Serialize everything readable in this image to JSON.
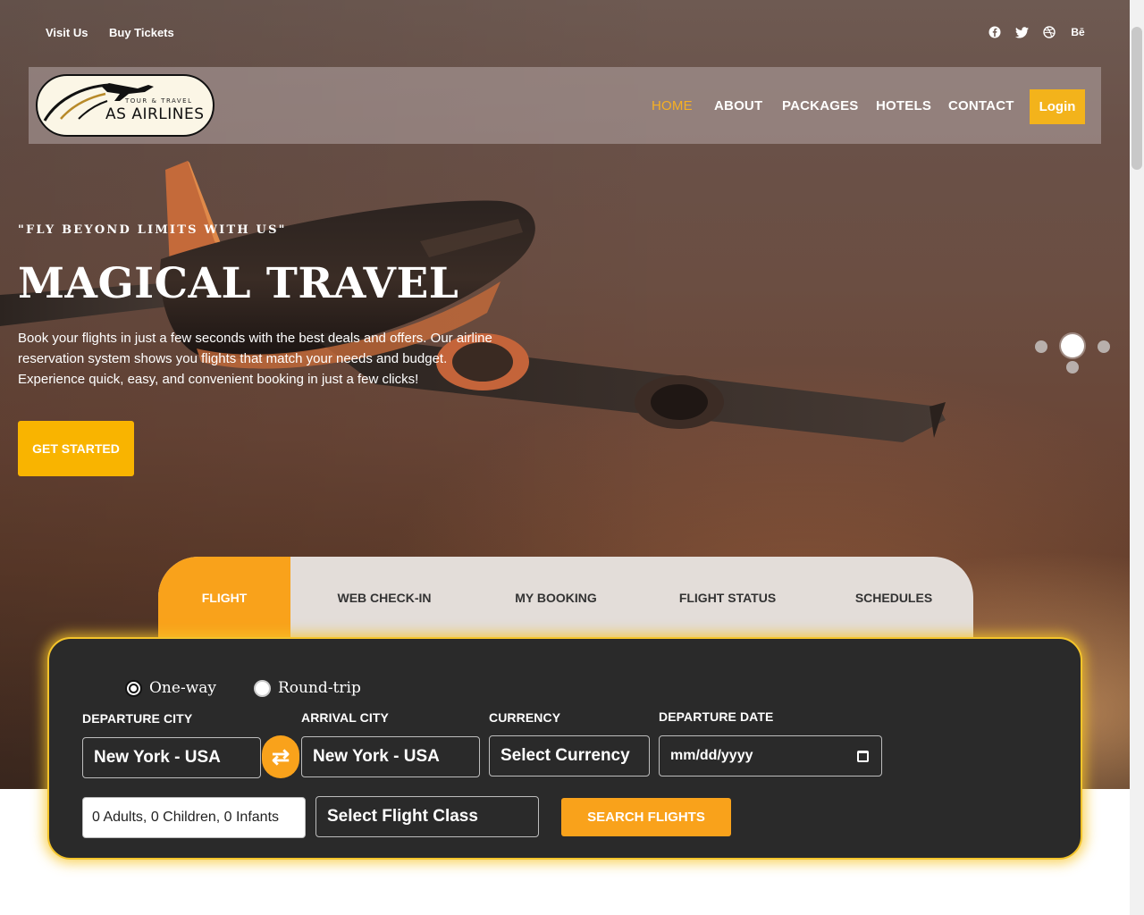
{
  "topbar": {
    "visit_us": "Visit Us",
    "buy_tickets": "Buy Tickets",
    "social": [
      {
        "icon": "facebook-icon",
        "glyph": "f"
      },
      {
        "icon": "twitter-icon",
        "glyph": "t"
      },
      {
        "icon": "dribbble-icon",
        "glyph": "✺"
      },
      {
        "icon": "behance-icon",
        "glyph": "Bē"
      }
    ]
  },
  "logo": {
    "small": "TOUR & TRAVEL",
    "big": "AS AIRLINES"
  },
  "nav": {
    "items": [
      "HOME",
      "ABOUT",
      "PACKAGES",
      "HOTELS",
      "CONTACT"
    ],
    "active": "HOME",
    "login": "Login"
  },
  "hero": {
    "tagline": "\"FLY BEYOND LIMITS WITH US\"",
    "headline": "MAGICAL TRAVEL",
    "description": "Book your flights in just a few seconds with the best deals and offers. Our airline reservation system shows you flights that match your needs and budget. Experience quick, easy, and convenient booking in just a few clicks!",
    "cta": "GET STARTED"
  },
  "tabs": {
    "items": [
      "FLIGHT",
      "WEB CHECK-IN",
      "MY BOOKING",
      "FLIGHT STATUS",
      "SCHEDULES"
    ],
    "active": "FLIGHT"
  },
  "booking": {
    "trip_types": [
      "One-way",
      "Round-trip"
    ],
    "selected_trip": "One-way",
    "labels": {
      "departure_city": "DEPARTURE CITY",
      "arrival_city": "ARRIVAL CITY",
      "currency": "CURRENCY",
      "departure_date": "DEPARTURE DATE"
    },
    "departure_city": "New York - USA",
    "arrival_city": "New York - USA",
    "currency": "Select Currency",
    "departure_date_placeholder": "mm/dd/yyyy",
    "passengers": "0 Adults, 0 Children, 0 Infants",
    "flight_class": "Select Flight Class",
    "search": "SEARCH FLIGHTS"
  },
  "colors": {
    "accent": "#f9a21b",
    "nav_active": "#f7b022",
    "panel": "#2a2a2a",
    "panel_glow": "#f4c42b"
  }
}
